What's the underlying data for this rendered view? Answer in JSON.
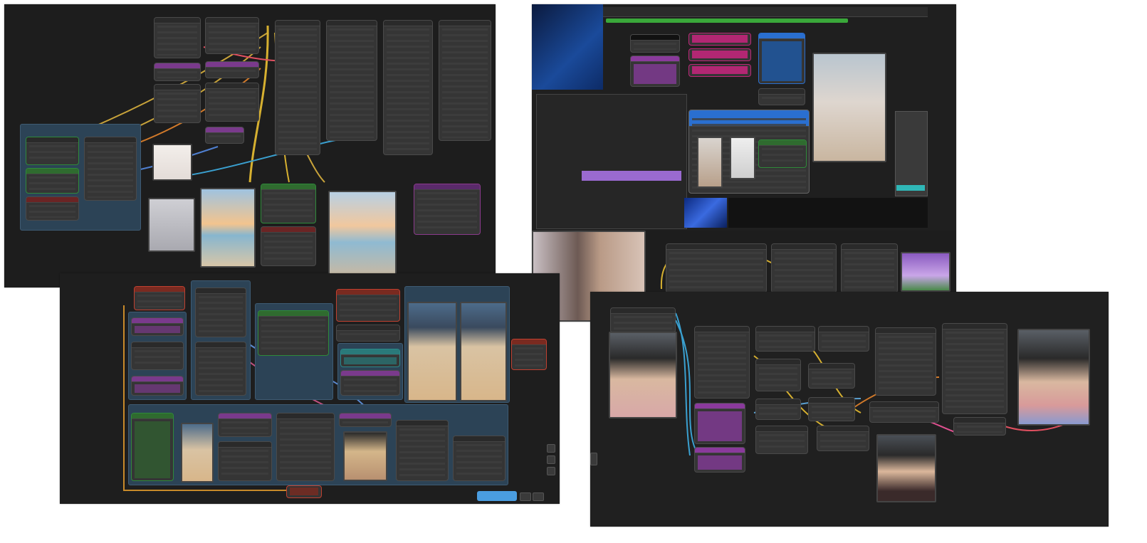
{
  "screenshots": [
    {
      "name": "comfyui-workflow-top-left"
    },
    {
      "name": "comfyui-workflow-top-right"
    },
    {
      "name": "comfyui-workflow-bottom-left"
    },
    {
      "name": "comfyui-workflow-bottom-right"
    }
  ],
  "colors": {
    "canvas": "#1d1d1d",
    "node": "#353535",
    "group_blue": "#2c4356",
    "purple": "#7a3a8c",
    "magenta": "#c0267a",
    "green": "#2f6b2f",
    "red_node": "#6b2424",
    "queue_button": "#4a9de0"
  },
  "icons": [
    "queue-button",
    "wire-link"
  ]
}
